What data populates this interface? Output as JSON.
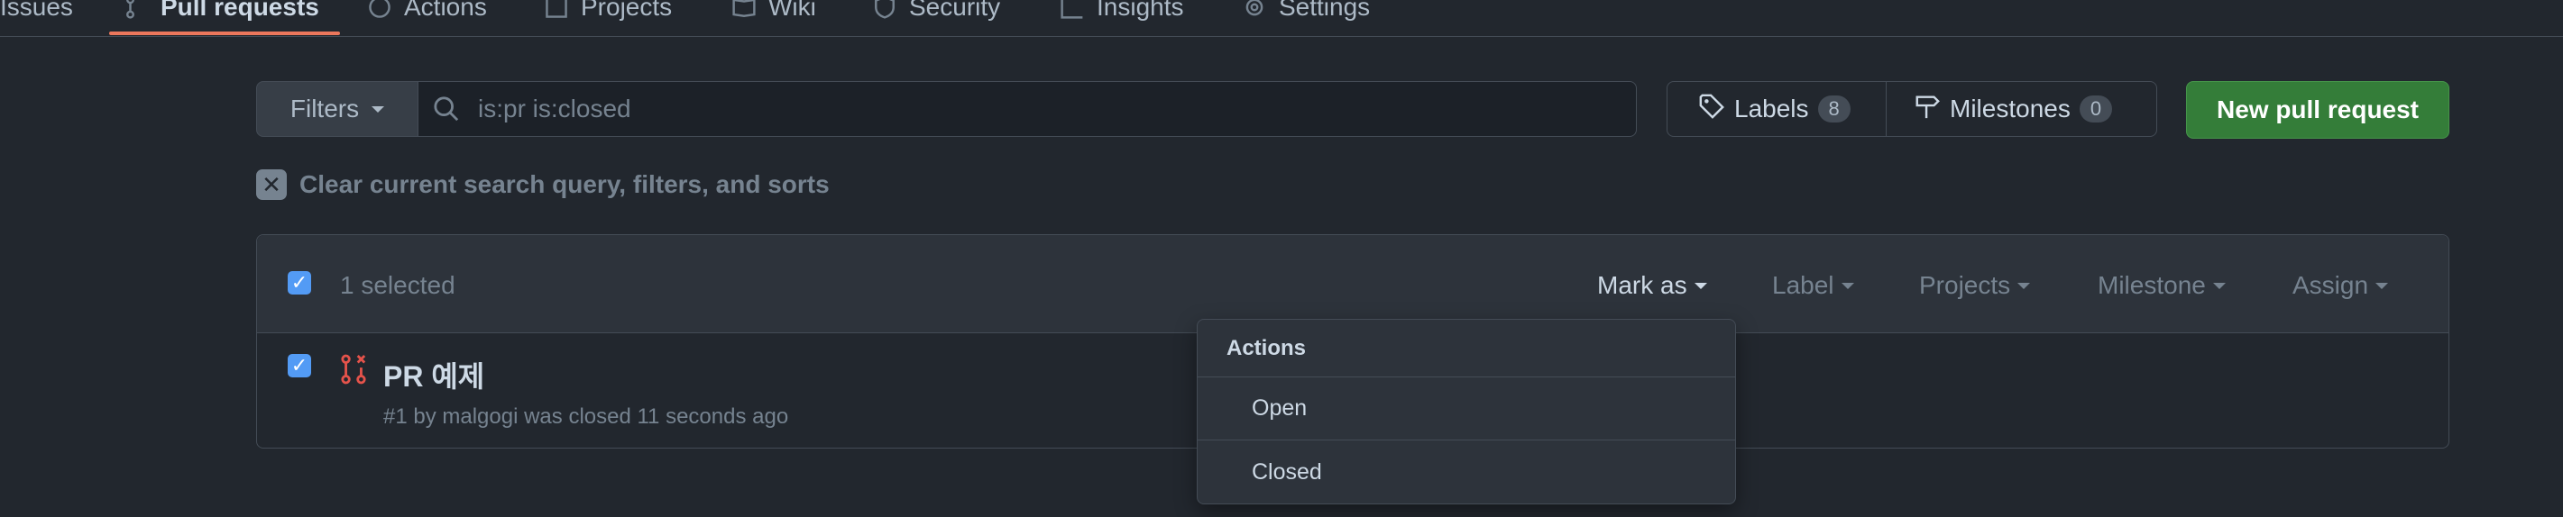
{
  "nav": {
    "tabs": [
      {
        "label": "Issues",
        "icon": "issue-icon"
      },
      {
        "label": "Pull requests",
        "icon": "pull-request-icon",
        "active": true
      },
      {
        "label": "Actions",
        "icon": "play-icon"
      },
      {
        "label": "Projects",
        "icon": "table-icon"
      },
      {
        "label": "Wiki",
        "icon": "book-icon"
      },
      {
        "label": "Security",
        "icon": "shield-icon"
      },
      {
        "label": "Insights",
        "icon": "graph-icon"
      },
      {
        "label": "Settings",
        "icon": "gear-icon"
      }
    ]
  },
  "filterbar": {
    "filters_label": "Filters",
    "search_value": "is:pr is:closed",
    "labels_label": "Labels",
    "labels_count": "8",
    "milestones_label": "Milestones",
    "milestones_count": "0",
    "new_pr_label": "New pull request"
  },
  "clear_filters": "Clear current search query, filters, and sorts",
  "list": {
    "selected_text": "1 selected",
    "actions": {
      "mark_as": "Mark as",
      "label": "Label",
      "projects": "Projects",
      "milestone": "Milestone",
      "assign": "Assign"
    },
    "items": [
      {
        "title": "PR 예제",
        "meta": "#1 by malgogi was closed 11 seconds ago",
        "state": "closed"
      }
    ]
  },
  "menu": {
    "header": "Actions",
    "items": [
      "Open",
      "Closed"
    ]
  },
  "colors": {
    "background": "#22272e",
    "accent_tab": "#ec775c",
    "primary_button": "#347d39",
    "closed_pr": "#e5534b",
    "checkbox": "#539bf5"
  }
}
